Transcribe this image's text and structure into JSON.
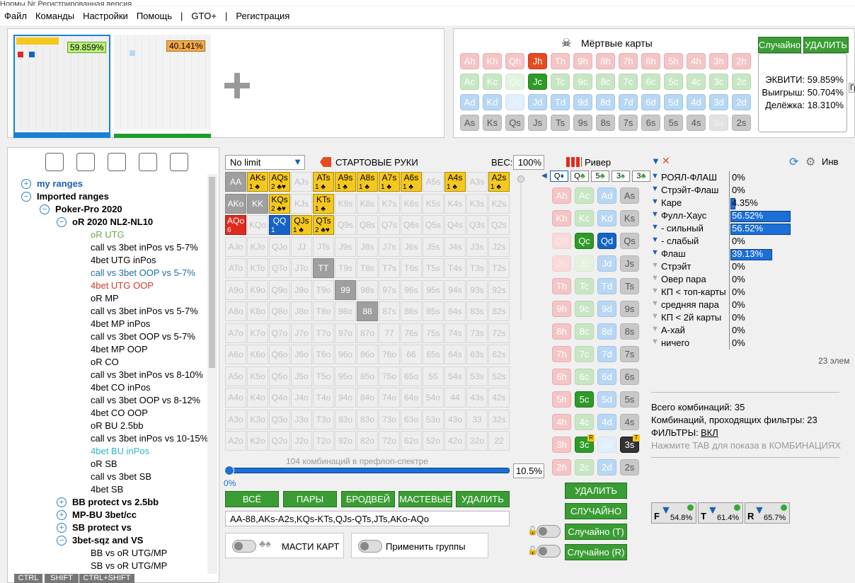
{
  "menu": [
    "Файл",
    "Команды",
    "Настройки",
    "Помощь",
    "|",
    "GTO+",
    "|",
    "Регистрация"
  ],
  "title_partial": "Нормы Nr Регистрированная версия",
  "ranges": {
    "r1": "59.859%",
    "r2": "40.141%"
  },
  "dead": {
    "title": "Мёртвые карты",
    "random": "Случайно",
    "delete": "УДАЛИТЬ"
  },
  "dead_cards": [
    [
      "Ah",
      "Kh",
      "Qh",
      "Jh",
      "Th",
      "9h",
      "8h",
      "7h",
      "6h",
      "5h",
      "4h",
      "3h",
      "2h"
    ],
    [
      "Ac",
      "Kc",
      "Qc",
      "Jc",
      "Tc",
      "9c",
      "8c",
      "7c",
      "6c",
      "5c",
      "4c",
      "3c",
      "2c"
    ],
    [
      "Ad",
      "Kd",
      "Qd",
      "Jd",
      "Td",
      "9d",
      "8d",
      "7d",
      "6d",
      "5d",
      "4d",
      "3d",
      "2d"
    ],
    [
      "As",
      "Ks",
      "Qs",
      "Js",
      "Ts",
      "9s",
      "8s",
      "7s",
      "6s",
      "5s",
      "4s",
      "3s",
      "2s"
    ]
  ],
  "equity": {
    "eq": "ЭКВИТИ: 59.859%",
    "win": "Выигрыш: 50.704%",
    "tie": "Делёжка: 18.310%",
    "side": "Гра"
  },
  "toolbar_icons": [
    "gear-icon",
    "user-icon",
    "filter-icon",
    "share-icon",
    "search-icon"
  ],
  "tree": [
    {
      "t": "my ranges",
      "lvl": 0,
      "tog": "+",
      "color": "#1a5fb4",
      "bold": true
    },
    {
      "t": "Imported ranges",
      "lvl": 0,
      "tog": "−",
      "bold": true
    },
    {
      "t": "Poker-Pro 2020",
      "lvl": 1,
      "tog": "−",
      "bold": true
    },
    {
      "t": "oR 2020 NL2-NL10",
      "lvl": 2,
      "tog": "−",
      "bold": true
    },
    {
      "t": "oR UTG",
      "lvl": 3,
      "color": "#6aa84f"
    },
    {
      "t": "call vs 3bet inPos vs 5-7%",
      "lvl": 3
    },
    {
      "t": "4bet UTG inPos",
      "lvl": 3
    },
    {
      "t": "call  vs 3bet OOP vs 5-7%",
      "lvl": 3,
      "color": "#1a6fa8"
    },
    {
      "t": "4bet UTG OOP",
      "lvl": 3,
      "color": "#cc3b2b"
    },
    {
      "t": "oR MP",
      "lvl": 3
    },
    {
      "t": "call vs 3bet inPos vs 5-7%",
      "lvl": 3
    },
    {
      "t": "4bet MP inPos",
      "lvl": 3
    },
    {
      "t": "call vs 3bet OOP vs 5-7%",
      "lvl": 3
    },
    {
      "t": "4bet MP OOP",
      "lvl": 3
    },
    {
      "t": "oR CO",
      "lvl": 3
    },
    {
      "t": "call vs 3bet inPos vs 8-10%",
      "lvl": 3
    },
    {
      "t": "4bet CO inPos",
      "lvl": 3
    },
    {
      "t": "call vs 3bet OOP vs 8-12%",
      "lvl": 3
    },
    {
      "t": "4bet CO OOP",
      "lvl": 3
    },
    {
      "t": "oR BU 2.5bb",
      "lvl": 3
    },
    {
      "t": "call vs 3bet inPos vs 10-15%",
      "lvl": 3
    },
    {
      "t": "4bet BU inPos",
      "lvl": 3,
      "color": "#2ab8c8"
    },
    {
      "t": "oR SB",
      "lvl": 3
    },
    {
      "t": "call vs 3bet SB",
      "lvl": 3
    },
    {
      "t": "4bet SB",
      "lvl": 3
    },
    {
      "t": "BB protect vs 2.5bb",
      "lvl": 2,
      "tog": "+",
      "bold": true
    },
    {
      "t": "MP-BU 3bet/cc",
      "lvl": 2,
      "tog": "+",
      "bold": true
    },
    {
      "t": "SB protect vs",
      "lvl": 2,
      "tog": "+",
      "bold": true
    },
    {
      "t": "3bet-sqz and VS",
      "lvl": 2,
      "tog": "−",
      "bold": true
    },
    {
      "t": "BB vs oR UTG/MP",
      "lvl": 3
    },
    {
      "t": "SB vs oR UTG/MP",
      "lvl": 3
    }
  ],
  "keys": [
    "CTRL",
    "SHIFT",
    "CTRL+SHIFT"
  ],
  "limit": "No limit",
  "start_hands": "СТАРТОВЫЕ РУКИ",
  "weight_label": "ВЕС:",
  "weight": "100%",
  "combos_label": "104 комбинаций в префлоп-спектре",
  "slider_min": "0%",
  "slider_val": "10.5%",
  "buttons": {
    "all": "ВСЁ",
    "pairs": "ПАРЫ",
    "broadway": "БРОДВЕЙ",
    "suited": "МАСТЕВЫЕ",
    "delete": "УДАЛИТЬ"
  },
  "range_text": "AA-88,AKs-A2s,KQs-KTs,QJs-QTs,JTs,AKo-AQo",
  "suits_label": "МАСТИ КАРТ",
  "groups_label": "Применить группы",
  "river": "Ривер",
  "board_tabs": [
    "Q",
    "Q",
    "5",
    "3",
    "3"
  ],
  "board_rows": [
    [
      "Ah",
      "Ac",
      "Ad",
      "As"
    ],
    [
      "Kh",
      "Kc",
      "Kd",
      "Ks"
    ],
    [
      "Qh",
      "Qc",
      "Qd",
      "Qs"
    ],
    [
      "Jh",
      "Jc",
      "Jd",
      "Js"
    ],
    [
      "Th",
      "Tc",
      "Td",
      "Ts"
    ],
    [
      "9h",
      "9c",
      "9d",
      "9s"
    ],
    [
      "8h",
      "8c",
      "8d",
      "8s"
    ],
    [
      "7h",
      "7c",
      "7d",
      "7s"
    ],
    [
      "6h",
      "6c",
      "6d",
      "6s"
    ],
    [
      "5h",
      "5c",
      "5d",
      "5s"
    ],
    [
      "4h",
      "4c",
      "4d",
      "4s"
    ],
    [
      "3h",
      "3c",
      "3d",
      "3s"
    ],
    [
      "2h",
      "2c",
      "2d",
      "2s"
    ]
  ],
  "board_badges": {
    "r": "R",
    "t": "T"
  },
  "board_buttons": {
    "delete": "УДАЛИТЬ",
    "random": "СЛУЧАЙНО",
    "random_t": "Случайно (T)",
    "random_r": "Случайно (R)"
  },
  "stats": [
    {
      "n": "РОЯЛ-ФЛАШ",
      "v": "0%",
      "w": 0
    },
    {
      "n": "Стрэйт-Флаш",
      "v": "0%",
      "w": 0
    },
    {
      "n": "Каре",
      "v": "4.35%",
      "w": 4.35
    },
    {
      "n": "Фулл-Хаус",
      "v": "56.52%",
      "w": 56.52
    },
    {
      "n": "- сильный",
      "v": "56.52%",
      "w": 56.52
    },
    {
      "n": "- слабый",
      "v": "0%",
      "w": 0
    },
    {
      "n": "Флаш",
      "v": "39.13%",
      "w": 39.13
    },
    {
      "n": "Стрэйт",
      "v": "0%",
      "w": 0
    },
    {
      "n": "Овер пара",
      "v": "0%",
      "w": 0
    },
    {
      "n": "КП < топ-карты",
      "v": "0%",
      "w": 0
    },
    {
      "n": "средняя пара",
      "v": "0%",
      "w": 0
    },
    {
      "n": "КП < 2й карты",
      "v": "0%",
      "w": 0
    },
    {
      "n": "А-хай",
      "v": "0%",
      "w": 0
    },
    {
      "n": "ничего",
      "v": "0%",
      "w": 0
    }
  ],
  "stats_header": "Инв",
  "elements": "23 элем",
  "total": "Всего комбинаций: 35",
  "passing": "Комбинаций, проходящих фильтры: 23",
  "filters_label": "ФИЛЬТРЫ:",
  "filters_val": "ВКЛ",
  "tab_hint": "Нажмите TAB для показа в КОМБИНАЦИЯХ",
  "streets": [
    {
      "l": "F",
      "v": "54.8%"
    },
    {
      "l": "T",
      "v": "61.4%"
    },
    {
      "l": "R",
      "v": "65.7%"
    }
  ]
}
